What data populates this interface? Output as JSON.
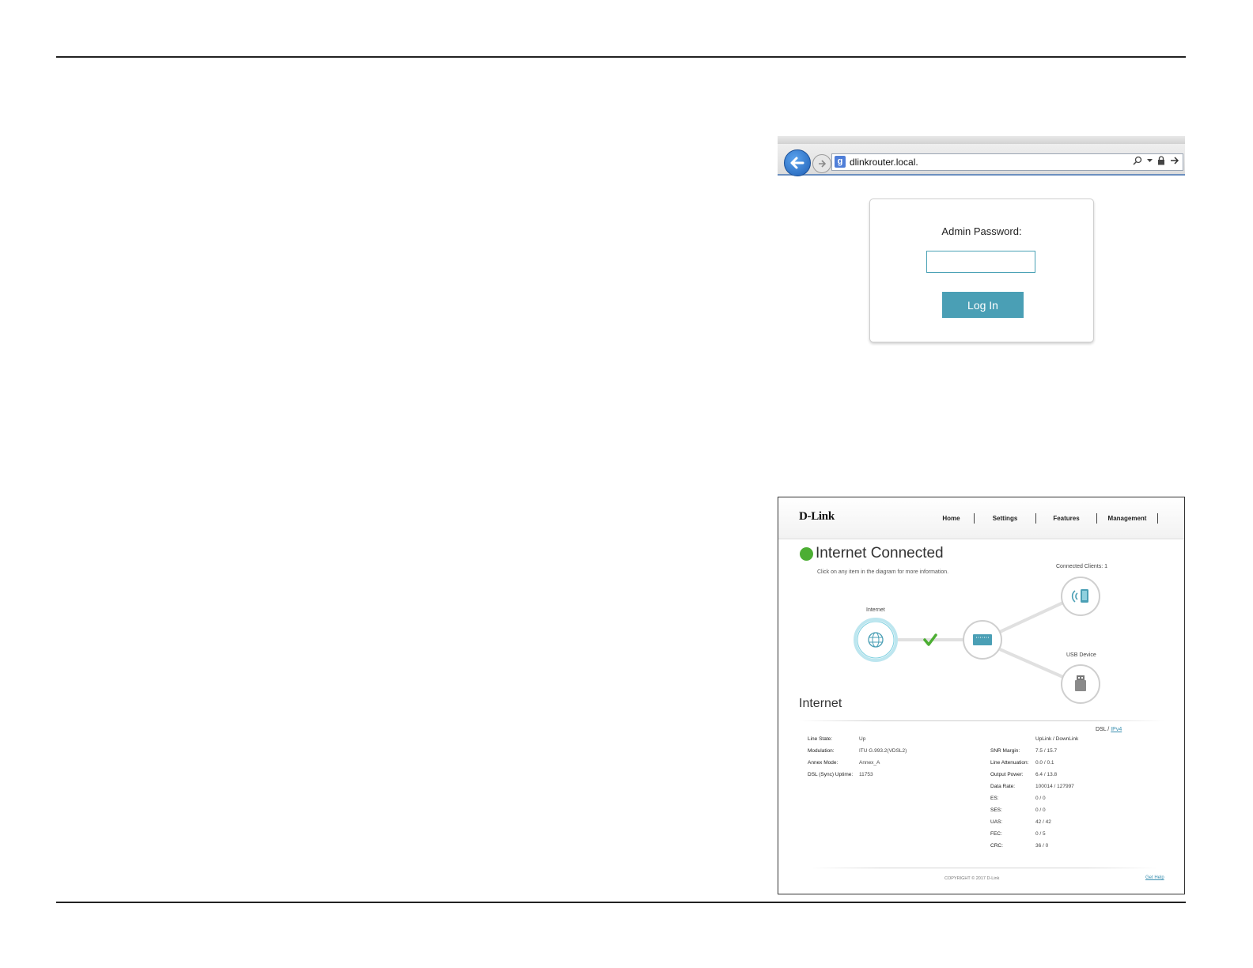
{
  "browser": {
    "url": "dlinkrouter.local.",
    "search_engine_glyph": "g"
  },
  "login": {
    "label": "Admin Password:",
    "password_value": "",
    "button_label": "Log In"
  },
  "dashboard": {
    "logo": "D-Link",
    "nav": [
      "Home",
      "Settings",
      "Features",
      "Management"
    ],
    "status_title": "Internet Connected",
    "status_subtitle": "Click on any item in the diagram for more information.",
    "status_color": "#4cae33",
    "accent_color": "#4a9fb5",
    "diagram": {
      "internet_label": "Internet",
      "clients_label": "Connected Clients: 1",
      "usb_label": "USB Device",
      "icons": [
        "globe-icon",
        "checkmark-icon",
        "router-icon",
        "wireless-client-icon",
        "usb-drive-icon"
      ]
    },
    "section_title": "Internet",
    "dsl_label": "DSL",
    "ipv4_link": "IPv4",
    "uplink_header": "UpLink / DownLink",
    "left_rows": [
      {
        "key": "Line State:",
        "value": "Up"
      },
      {
        "key": "Modulation:",
        "value": "ITU G.993.2(VDSL2)"
      },
      {
        "key": "Annex Mode:",
        "value": "Annex_A"
      },
      {
        "key": "DSL (Sync) Uptime:",
        "value": "11753"
      }
    ],
    "right_rows": [
      {
        "key": "SNR Margin:",
        "value": "7.5 / 15.7"
      },
      {
        "key": "Line Attenuation:",
        "value": "0.0 / 0.1"
      },
      {
        "key": "Output Power:",
        "value": "6.4 / 13.8"
      },
      {
        "key": "Data Rate:",
        "value": "100014 / 127997"
      },
      {
        "key": "ES:",
        "value": "0 / 0"
      },
      {
        "key": "SES:",
        "value": "0 / 0"
      },
      {
        "key": "UAS:",
        "value": "42 / 42"
      },
      {
        "key": "FEC:",
        "value": "0 / 5"
      },
      {
        "key": "CRC:",
        "value": "36 / 0"
      }
    ],
    "copyright": "COPYRIGHT © 2017 D-Link",
    "get_help": "Get Help"
  }
}
